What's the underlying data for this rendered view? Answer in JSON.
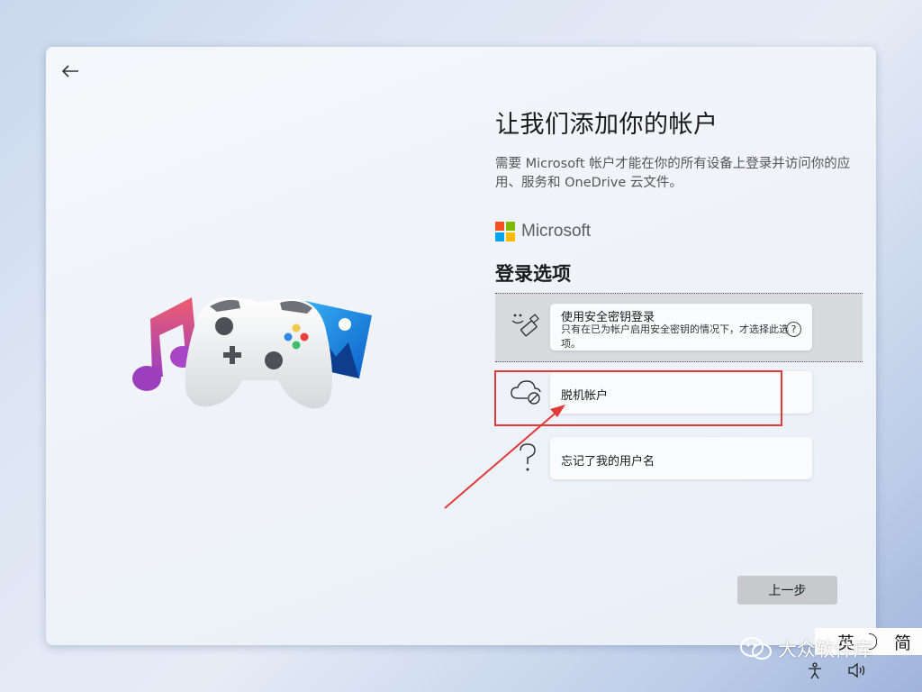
{
  "page": {
    "title": "让我们添加你的帐户",
    "description": "需要 Microsoft 帐户才能在你的所有设备上登录并访问你的应用、服务和 OneDrive 云文件。",
    "brand": "Microsoft",
    "section_title": "登录选项"
  },
  "colors": {
    "ms_red": "#f25022",
    "ms_green": "#7fba00",
    "ms_blue": "#00a4ef",
    "ms_yellow": "#ffb900",
    "highlight": "#e03a3a"
  },
  "options": [
    {
      "icon": "security-key-icon",
      "label": "使用安全密钥登录",
      "detail": "只有在已为帐户启用安全密钥的情况下，才选择此选项。",
      "help": "?"
    },
    {
      "icon": "offline-cloud-icon",
      "label": "脱机帐户"
    },
    {
      "icon": "question-mark-icon",
      "label": "忘记了我的用户名"
    }
  ],
  "footer": {
    "prev_label": "上一步"
  },
  "ime": {
    "lang_en": "英",
    "lang_sc": "简"
  },
  "watermark": {
    "text": "大众软件库"
  }
}
